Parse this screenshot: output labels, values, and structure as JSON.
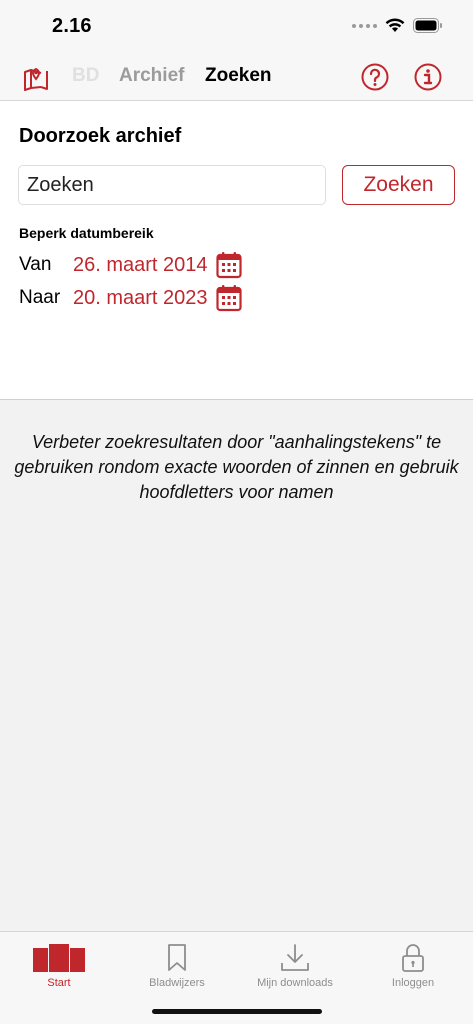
{
  "status_bar": {
    "time": "2.16"
  },
  "nav": {
    "tab_bd": "BD",
    "tab_archief": "Archief",
    "tab_zoeken": "Zoeken",
    "icons": [
      "map-icon",
      "help-icon",
      "info-icon"
    ]
  },
  "search": {
    "title": "Doorzoek archief",
    "input_value": "Zoeken",
    "input_placeholder": "Zoeken",
    "button_label": "Zoeken",
    "range_label": "Beperk datumbereik",
    "from_label": "Van",
    "from_date": "26. maart 2014",
    "to_label": "Naar",
    "to_date": "20. maart 2023"
  },
  "hint": "Verbeter zoekresultaten door \"aanhalingstekens\" te gebruiken rondom exacte woorden of zinnen en gebruik hoofdletters voor namen",
  "tabbar": {
    "start": "Start",
    "bladwijzers": "Bladwijzers",
    "downloads": "Mijn downloads",
    "inloggen": "Inloggen"
  },
  "colors": {
    "accent": "#c0272d",
    "inactive": "#8e8e8e",
    "background": "#f2f2f2"
  }
}
